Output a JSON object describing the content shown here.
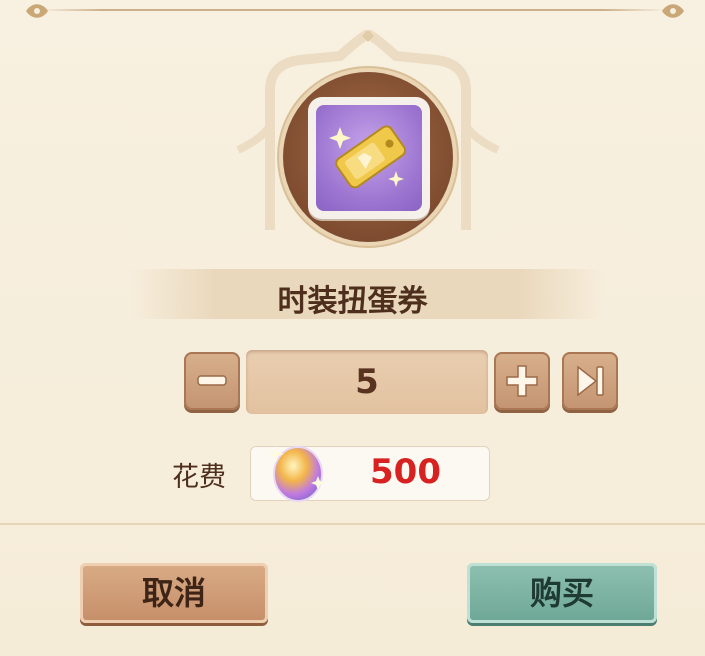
{
  "item": {
    "name": "时装扭蛋券",
    "icon": "gacha-ticket-icon"
  },
  "quantity": {
    "value": "5",
    "decrease_icon": "minus-icon",
    "increase_icon": "plus-icon",
    "max_icon": "skip-to-max-icon"
  },
  "cost": {
    "label": "花费",
    "currency_icon": "crystal-orb-icon",
    "value": "500"
  },
  "actions": {
    "cancel_label": "取消",
    "buy_label": "购买"
  },
  "colors": {
    "cost_red": "#d72221",
    "buy_green": "#7eb3a4",
    "cancel_tan": "#cf9d77"
  }
}
